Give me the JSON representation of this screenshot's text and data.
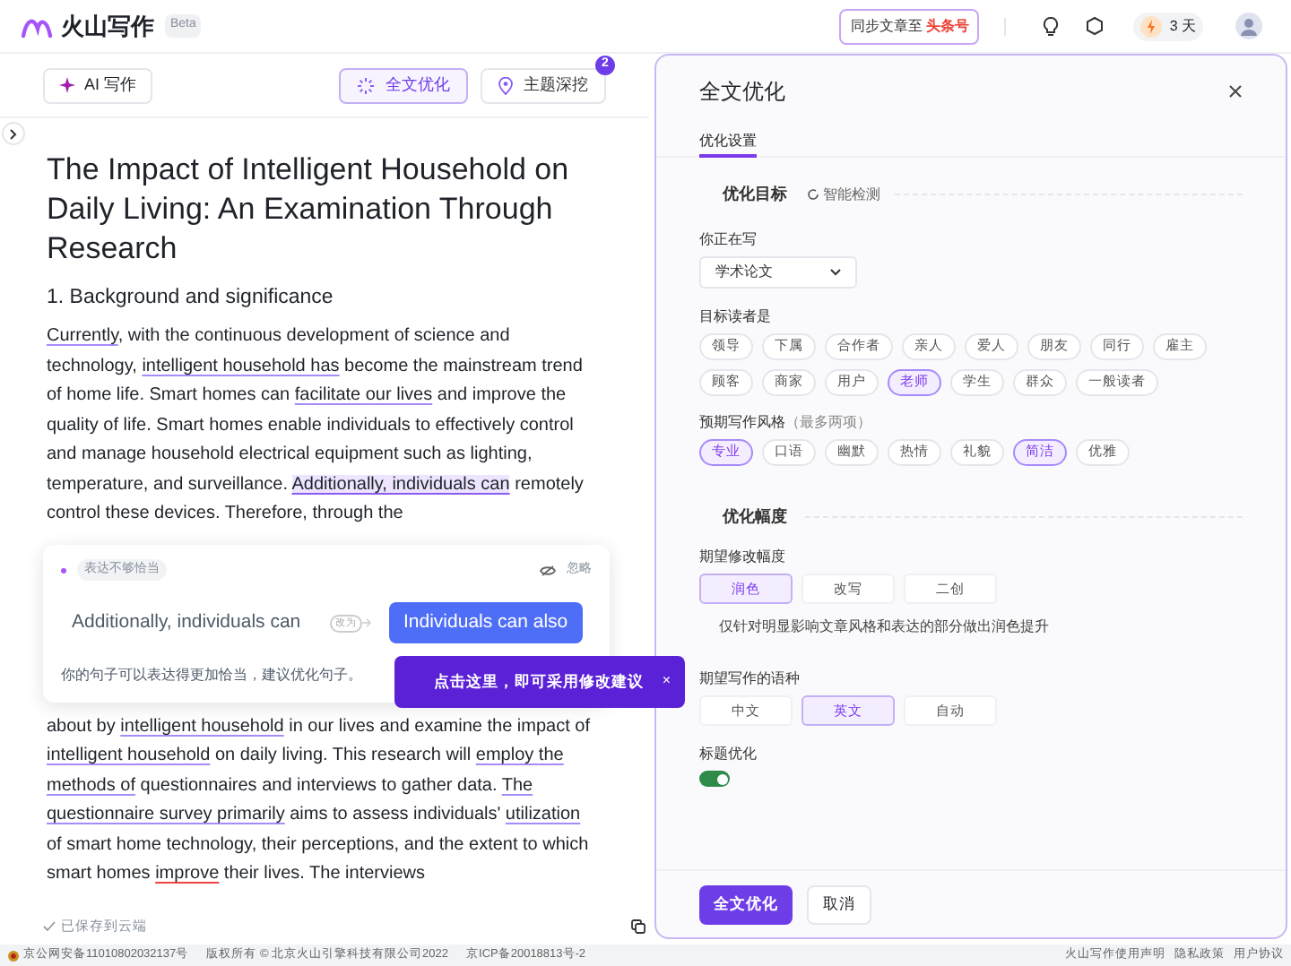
{
  "header": {
    "app_name": "火山写作",
    "badge": "Beta",
    "sync_button": {
      "text": "同步文章至",
      "target": "头条号"
    },
    "days_badge": "3 天"
  },
  "toolbar": {
    "ai_button": "AI 写作",
    "buttons": [
      {
        "label": "全文优化",
        "selected": true
      },
      {
        "label": "主题深挖",
        "selected": false,
        "count": "2"
      }
    ]
  },
  "document": {
    "title": "The Impact of Intelligent Household on Daily Living: An Examination Through Research",
    "heading": "1. Background and significance",
    "paragraph_before": [
      {
        "text": "Currently",
        "color": "#a78bfa"
      },
      {
        "text": ", with the continuous development of science and technology, "
      },
      {
        "text": "intelligent household has",
        "color": "#a78bfa"
      },
      {
        "text": " become the mainstream trend of home life. Smart homes can "
      },
      {
        "text": "facilitate our lives",
        "color": "#a78bfa"
      },
      {
        "text": " and improve the quality of life. Smart homes enable individuals to effectively control and manage household electrical equipment such as lighting, temperature, and surveillance. "
      },
      {
        "text": "Additionally, individuals can",
        "color": "#8b5cf6",
        "highlighted": true
      },
      {
        "text": " remotely control these devices. Therefore, through the"
      }
    ],
    "paragraph_after": [
      {
        "text": "about by "
      },
      {
        "text": "intelligent household",
        "color": "#a78bfa"
      },
      {
        "text": " in our lives and examine the impact of "
      },
      {
        "text": "intelligent household",
        "color": "#a78bfa"
      },
      {
        "text": " on daily living. This research will "
      },
      {
        "text": "employ ",
        "color": "#a78bfa"
      },
      {
        "text": "the methods of",
        "color": "#a78bfa"
      },
      {
        "text": " questionnaires and interviews to gather data. "
      },
      {
        "text": "The questionnaire survey primarily",
        "color": "#a78bfa"
      },
      {
        "text": " aims to assess individuals' "
      },
      {
        "text": "utilization",
        "color": "#a78bfa"
      },
      {
        "text": " of smart home technology, their perceptions, and the extent to which smart homes "
      },
      {
        "text": "improve",
        "color": "#ef4444"
      },
      {
        "text": " their lives. The interviews"
      }
    ],
    "save_status": "已保存到云端"
  },
  "suggestion": {
    "tag": "表达不够恰当",
    "ignore": "忽略",
    "original": "Additionally, individuals can",
    "arrow_label": "改为",
    "replacement": "Individuals can also",
    "explanation": "你的句子可以表达得更加恰当，建议优化句子。"
  },
  "tooltip": {
    "text": "点击这里，即可采用修改建议",
    "close": "×"
  },
  "panel": {
    "title": "全文优化",
    "tabs": [
      {
        "label": "优化设置",
        "selected": true
      }
    ],
    "section_1": {
      "title": "优化目标",
      "detect": "智能检测"
    },
    "writing_label": "你正在写",
    "writing_value": "学术论文",
    "readers_label": "目标读者是",
    "readers": [
      {
        "label": "领导",
        "selected": false
      },
      {
        "label": "下属",
        "selected": false
      },
      {
        "label": "合作者",
        "selected": false
      },
      {
        "label": "亲人",
        "selected": false
      },
      {
        "label": "爱人",
        "selected": false
      },
      {
        "label": "朋友",
        "selected": false
      },
      {
        "label": "同行",
        "selected": false
      },
      {
        "label": "雇主",
        "selected": false
      },
      {
        "label": "顾客",
        "selected": false
      },
      {
        "label": "商家",
        "selected": false
      },
      {
        "label": "用户",
        "selected": false
      },
      {
        "label": "老师",
        "selected": true
      },
      {
        "label": "学生",
        "selected": false
      },
      {
        "label": "群众",
        "selected": false
      },
      {
        "label": "一般读者",
        "selected": false
      }
    ],
    "style_label": "预期写作风格",
    "style_hint": "（最多两项）",
    "styles": [
      {
        "label": "专业",
        "selected": true
      },
      {
        "label": "口语",
        "selected": false
      },
      {
        "label": "幽默",
        "selected": false
      },
      {
        "label": "热情",
        "selected": false
      },
      {
        "label": "礼貌",
        "selected": false
      },
      {
        "label": "简洁",
        "selected": true
      },
      {
        "label": "优雅",
        "selected": false
      }
    ],
    "section_2": {
      "title": "优化幅度"
    },
    "degree_label": "期望修改幅度",
    "degrees": [
      {
        "label": "润色",
        "selected": true
      },
      {
        "label": "改写",
        "selected": false
      },
      {
        "label": "二创",
        "selected": false
      }
    ],
    "degree_hint": "仅针对明显影响文章风格和表达的部分做出润色提升",
    "language_label": "期望写作的语种",
    "languages": [
      {
        "label": "中文",
        "selected": false
      },
      {
        "label": "英文",
        "selected": true
      },
      {
        "label": "自动",
        "selected": false
      }
    ],
    "title_opt_label": "标题优化",
    "title_opt_on": true,
    "submit": "全文优化",
    "cancel": "取消"
  },
  "footer": {
    "left": [
      "京公网安备11010802032137号",
      "版权所有 © 北京火山引擎科技有限公司2022",
      "京ICP备20018813号-2"
    ],
    "right": [
      "火山写作使用声明",
      "隐私政策",
      "用户协议"
    ]
  }
}
